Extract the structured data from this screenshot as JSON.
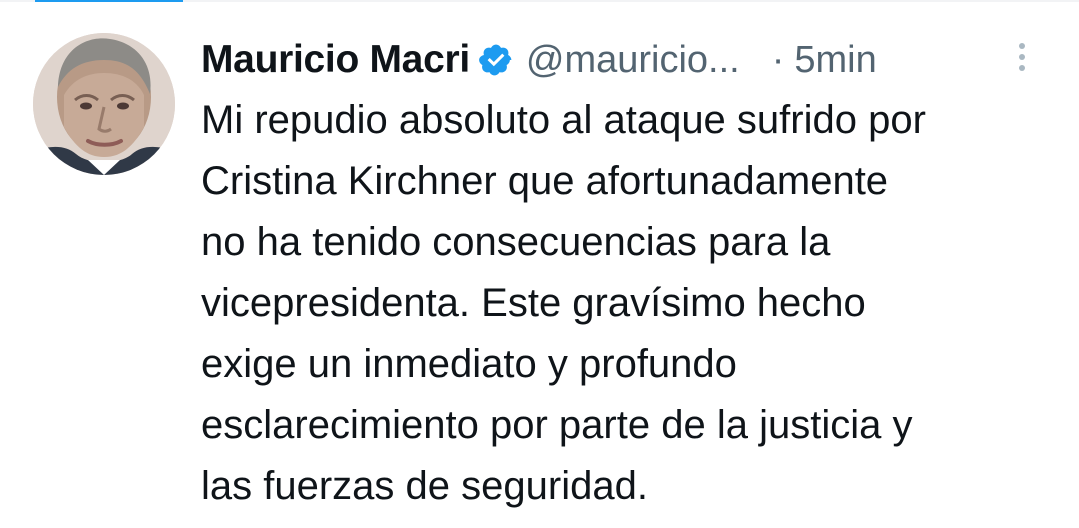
{
  "tweet": {
    "author_name": "Mauricio Macri",
    "handle": "@mauricio...",
    "separator": "·",
    "time": "5min",
    "text_lines": [
      "Mi repudio absoluto al ataque sufrido por",
      "Cristina Kirchner que afortunadamente",
      "no ha tenido consecuencias para la",
      "vicepresidenta. Este gravísimo hecho",
      "exige un inmediato y profundo",
      "esclarecimiento por parte de la justicia y",
      "las fuerzas de seguridad."
    ]
  },
  "icons": {
    "verified": "verified-badge-icon",
    "more": "more-options-icon",
    "avatar": "profile-photo"
  },
  "colors": {
    "text": "#0f1419",
    "muted": "#536471",
    "brand_blue": "#1d9bf0",
    "background": "#ffffff"
  }
}
